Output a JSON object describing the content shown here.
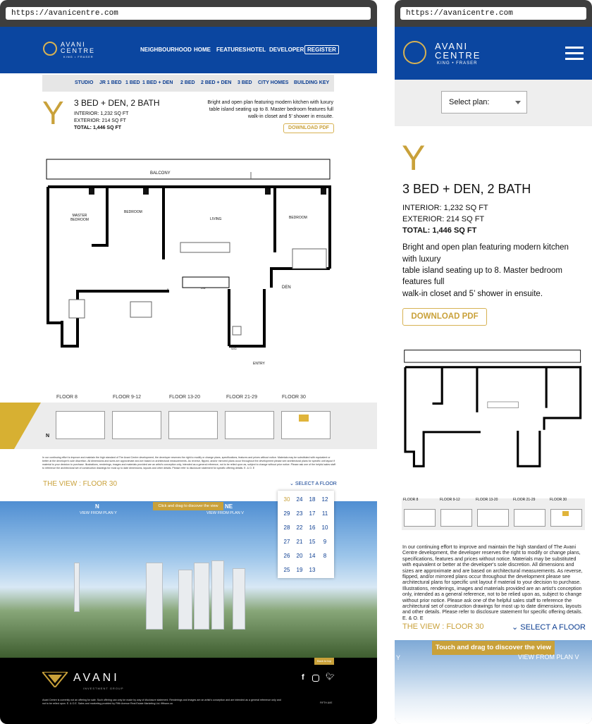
{
  "desktop": {
    "url": "https://avanicentre.com",
    "logo": {
      "line1": "AVANI",
      "line2": "CENTRE",
      "tag": "KING • FRASER"
    },
    "nav": [
      "NEIGHBOURHOOD",
      "HOME",
      "FEATURES",
      "HOTEL",
      "DEVELOPER",
      "REGISTER"
    ],
    "subnav": [
      "STUDIO",
      "JR 1 BED",
      "1 BED",
      "1 BED + DEN",
      "2 BED",
      "2 BED + DEN",
      "3 BED",
      "CITY HOMES",
      "BUILDING KEY"
    ],
    "plan": {
      "letter": "Y",
      "title": "3 BED + DEN, 2 BATH",
      "interior": "INTERIOR: 1,232 SQ FT",
      "exterior": "EXTERIOR: 214 SQ FT",
      "total": "TOTAL: 1,446 SQ FT",
      "desc": "Bright and open plan featuring modern kitchen with luxury table island seating up to 8. Master bedroom features full walk-in closet and 5’ shower in ensuite.",
      "download": "DOWNLOAD PDF"
    },
    "floorplan_labels": {
      "balcony": "BALCONY",
      "master": "MASTER BEDROOM",
      "bedroom": "BEDROOM",
      "living": "LIVING",
      "bedroom2": "BEDROOM",
      "den": "DEN",
      "entry": "ENTRY",
      "wd": "W/D",
      "dw": "DW",
      "f": "F"
    },
    "floors": [
      "FLOOR 8",
      "FLOOR 9-12",
      "FLOOR 13-20",
      "FLOOR 21-29",
      "FLOOR 30"
    ],
    "compass": "N",
    "disclaimer": "In our continuing effort to improve and maintain the high standard of The Avani Centre development, the developer reserves the right to modify or change plans, specifications, features and prices without notice. Materials may be substituted with equivalent or better at the developer's sole discretion. All dimensions and sizes are approximate and are based on architectural measurements. As reverse, flipped, and/or mirrored plans occur throughout the development please see architectural plans for specific unit layout if material to your decision to purchase. Illustrations, renderings, images and materials provided are an artist's conception only, intended as a general reference, not to be relied upon as, subject to change without prior notice. Please ask one of the helpful sales staff to reference the architectural set of construction drawings for most up to date dimensions, layouts and other details. Please refer to disclosure statement for specific offering details. E. & O. E",
    "view_title": "THE VIEW : FLOOR 30",
    "select_floor": "SELECT A FLOOR",
    "floor_numbers": [
      [
        "30",
        "24",
        "18",
        "12"
      ],
      [
        "29",
        "23",
        "17",
        "11"
      ],
      [
        "28",
        "22",
        "16",
        "10"
      ],
      [
        "27",
        "21",
        "15",
        "9"
      ],
      [
        "26",
        "20",
        "14",
        "8"
      ],
      [
        "25",
        "19",
        "13",
        ""
      ]
    ],
    "drag_banner": "Click and drag to discover the view",
    "compass_n": "N",
    "compass_ne": "NE",
    "view_from_1": "VIEW FROM PLAN Y",
    "view_from_2": "VIEW FROM PLAN V",
    "back_to_top": "Back to top",
    "footer_logo": "AVANI",
    "footer_sub": "INVESTMENT GROUP",
    "footer_text": "Avani Centre is currently not an offering for sale. Such offering can only be made by way of disclosure statement. Renderings and images are an artist's conception and are intended as a general reference only and not to be relied upon. E. & O.E. Sales and marketing provided by Fifth Avenue Real Estate Marketing Ltd. fifthave.ca",
    "footer_badge": "FIFTH AVE"
  },
  "mobile": {
    "url": "https://avanicentre.com",
    "select_label": "Select plan:",
    "letter": "Y",
    "title": "3 BED + DEN, 2 BATH",
    "interior": "INTERIOR: 1,232 SQ FT",
    "exterior": "EXTERIOR: 214 SQ FT",
    "total": "TOTAL: 1,446 SQ FT",
    "desc_1": "Bright and open plan featuring modern kitchen",
    "desc_2": "with luxury",
    "desc_3": "table island seating up to 8. Master bedroom",
    "desc_4": "features full",
    "desc_5": "walk-in closet and 5’ shower in ensuite.",
    "download": "DOWNLOAD PDF",
    "floors": [
      "FLOOR 8",
      "FLOOR 9-12",
      "FLOOR 13-20",
      "FLOOR 21-29",
      "FLOOR 30"
    ],
    "disclaimer": "In our continuing effort to improve and maintain the high standard of The Avani Centre development, the developer reserves the right to modify or change plans, specifications, features and prices without notice. Materials may be substituted with equivalent or better at the developer's sole discretion. All dimensions and sizes are approximate and are based on architectural measurements. As reverse, flipped, and/or mirrored plans occur throughout the development please see architectural plans for specific unit layout if material to your decision to purchase. Illustrations, renderings, images and materials provided are an artist's conception only, intended as a general reference, not to be relied upon as, subject to change without prior notice. Please ask one of the helpful sales staff to reference the architectural set of construction drawings for most up to date dimensions, layouts and other details. Please refer to disclosure statement for specific offering details. E. & O. E",
    "view_title": "THE VIEW : FLOOR 30",
    "select_floor": "SELECT A FLOOR",
    "drag_banner": "Touch and drag to discover the view",
    "compass_y": "Y",
    "view_from": "VIEW FROM PLAN V"
  },
  "colors": {
    "brand_blue": "#0b46a0",
    "gold": "#c9a13a",
    "link_blue": "#0b3d91"
  }
}
